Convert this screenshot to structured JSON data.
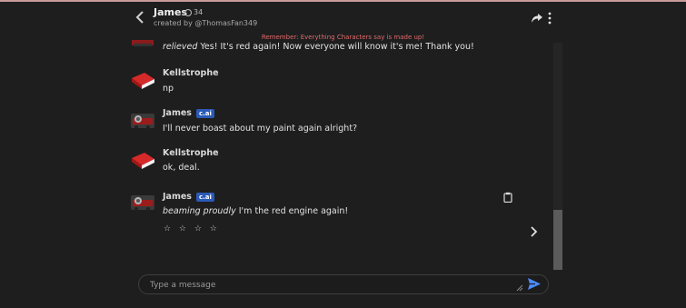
{
  "header": {
    "name": "James",
    "count": "34",
    "creator": "created by @ThomasFan349"
  },
  "disclaimer": "Remember: Everything Characters say is made up!",
  "messages": [
    {
      "author": "",
      "badge": "",
      "italic": "relieved",
      "text": " Yes! It's red again! Now everyone will know it's me! Thank you!"
    },
    {
      "author": "Kellstrophe",
      "badge": "",
      "italic": "",
      "text": "np"
    },
    {
      "author": "James",
      "badge": "c.ai",
      "italic": "",
      "text": "I'll never boast about my paint again alright?"
    },
    {
      "author": "Kellstrophe",
      "badge": "",
      "italic": "",
      "text": "ok, deal."
    },
    {
      "author": "James",
      "badge": "c.ai",
      "italic": "beaming proudly",
      "text": " I'm the red engine again!"
    }
  ],
  "rating": "☆ ☆ ☆ ☆",
  "composer": {
    "placeholder": "Type a message"
  },
  "colors": {
    "accent": "#4a8cff",
    "disclaimer": "#e0696a",
    "badge": "#2a5ab8"
  }
}
